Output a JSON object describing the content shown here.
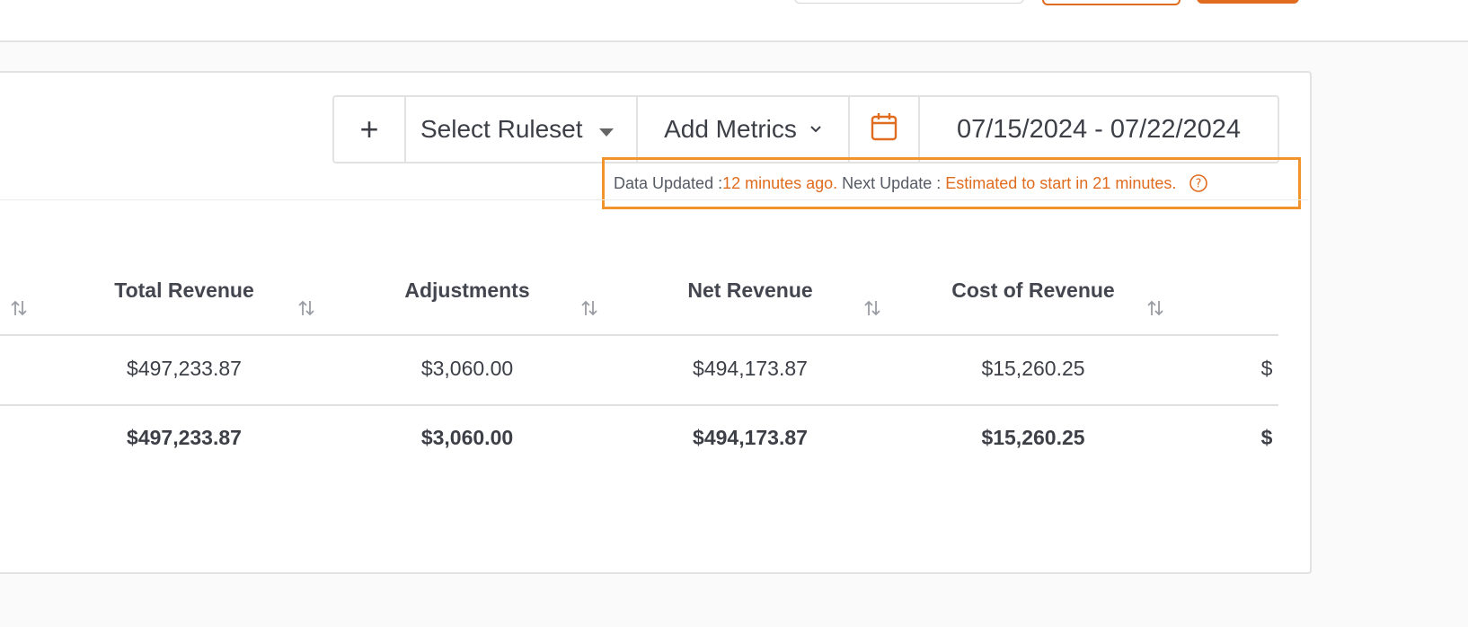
{
  "toolbar": {
    "add_label": "+",
    "ruleset_label": "Select Ruleset",
    "metrics_label": "Add Metrics",
    "date_range": "07/15/2024 - 07/22/2024"
  },
  "status": {
    "updated_label": "Data Updated : ",
    "updated_value": "12 minutes ago.",
    "next_label": " Next Update : ",
    "next_value": "Estimated to start in 21 minutes."
  },
  "table": {
    "columns": [
      "Total Revenue",
      "Adjustments",
      "Net Revenue",
      "Cost of Revenue"
    ],
    "rows": [
      [
        "$497,233.87",
        "$3,060.00",
        "$494,173.87",
        "$15,260.25"
      ]
    ],
    "totals": [
      "$497,233.87",
      "$3,060.00",
      "$494,173.87",
      "$15,260.25"
    ],
    "cut_off_partial": "$",
    "cut_off_partial_total": "$"
  },
  "colors": {
    "accent": "#e06c1f",
    "highlight_border": "#f0942b"
  },
  "icons": {
    "calendar": "calendar-icon",
    "help": "help-circle-icon",
    "sort": "sort-arrows-icon"
  }
}
